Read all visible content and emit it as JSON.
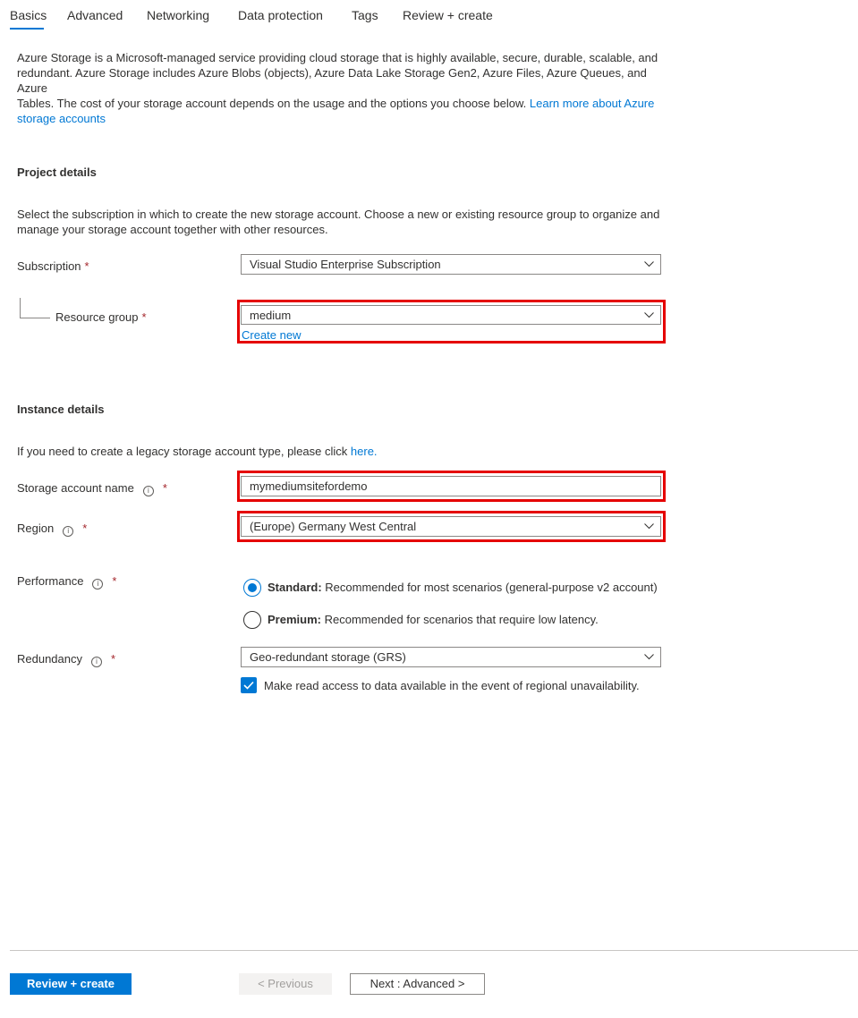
{
  "tabs": [
    {
      "label": "Basics"
    },
    {
      "label": "Advanced"
    },
    {
      "label": "Networking"
    },
    {
      "label": "Data protection"
    },
    {
      "label": "Tags"
    },
    {
      "label": "Review + create"
    }
  ],
  "intro": {
    "line1": "Azure Storage is a Microsoft-managed service providing cloud storage that is highly available, secure, durable, scalable, and",
    "line2": "redundant. Azure Storage includes Azure Blobs (objects), Azure Data Lake Storage Gen2, Azure Files, Azure Queues, and Azure",
    "line3": "Tables. The cost of your storage account depends on the usage and the options you choose below.",
    "link_part1": "Learn more about Azure",
    "link_part2": "storage accounts"
  },
  "project": {
    "title": "Project details",
    "description_line1": "Select the subscription in which to create the new storage account. Choose a new or existing resource group to organize and",
    "description_line2": "manage your storage account together with other resources.",
    "subscription_label": "Subscription",
    "subscription_value": "Visual Studio Enterprise Subscription",
    "resource_group_label": "Resource group",
    "resource_group_value": "medium",
    "create_new": "Create new"
  },
  "instance": {
    "title": "Instance details",
    "legacy_text": "If you need to create a legacy storage account type, please click",
    "legacy_link": "here.",
    "name_label": "Storage account name",
    "name_value": "mymediumsitefordemo",
    "region_label": "Region",
    "region_value": "(Europe) Germany West Central",
    "performance_label": "Performance",
    "standard_title": "Standard:",
    "standard_desc": "Recommended for most scenarios (general-purpose v2 account)",
    "premium_title": "Premium:",
    "premium_desc": "Recommended for scenarios that require low latency.",
    "redundancy_label": "Redundancy",
    "redundancy_value": "Geo-redundant storage (GRS)",
    "read_access_text": "Make read access to data available in the event of regional unavailability."
  },
  "required_mark": "*",
  "info_glyph": "i",
  "footer": {
    "review_create": "Review + create",
    "previous": "< Previous",
    "next": "Next : Advanced >"
  },
  "colors": {
    "accent": "#0078d4",
    "highlight": "#e50000",
    "required": "#a4262c"
  }
}
